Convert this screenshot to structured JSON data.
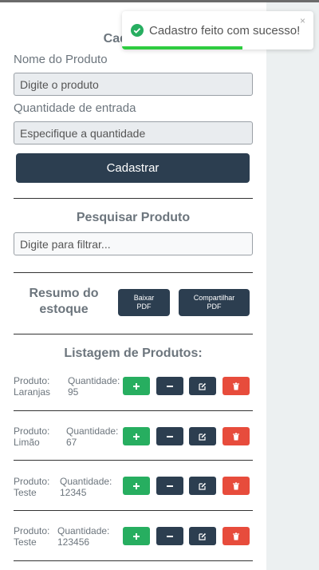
{
  "form": {
    "title": "Cadastrar",
    "product_label": "Nome do Produto",
    "product_placeholder": "Digite o produto",
    "quantity_label": "Quantidade de entrada",
    "quantity_placeholder": "Especifique a quantidade",
    "submit_label": "Cadastrar"
  },
  "search": {
    "title": "Pesquisar Produto",
    "placeholder": "Digite para filtrar..."
  },
  "summary": {
    "title_line1": "Resumo do",
    "title_line2": "estoque",
    "download_line1": "Baixar",
    "download_line2": "PDF",
    "share_line1": "Compartilhar",
    "share_line2": "PDF"
  },
  "list": {
    "title": "Listagem de Produtos:",
    "product_label": "Produto:",
    "quantity_label": "Quantidade:",
    "items": [
      {
        "name": "Laranjas",
        "quantity": "95"
      },
      {
        "name": "Limão",
        "quantity": "67"
      },
      {
        "name": "Teste",
        "quantity": "12345"
      },
      {
        "name": "Teste",
        "quantity": "123456"
      }
    ],
    "actions": [
      "plus-icon",
      "minus-icon",
      "edit-icon",
      "trash-icon"
    ]
  },
  "toast": {
    "message": "Cadastro feito com sucesso!",
    "close": "×",
    "icon": "check-circle-icon",
    "progress": 0.63
  },
  "colors": {
    "primary": "#2c3e50",
    "success": "#27ae60",
    "danger": "#e74c3c",
    "toast_progress": "#2ecc40"
  }
}
